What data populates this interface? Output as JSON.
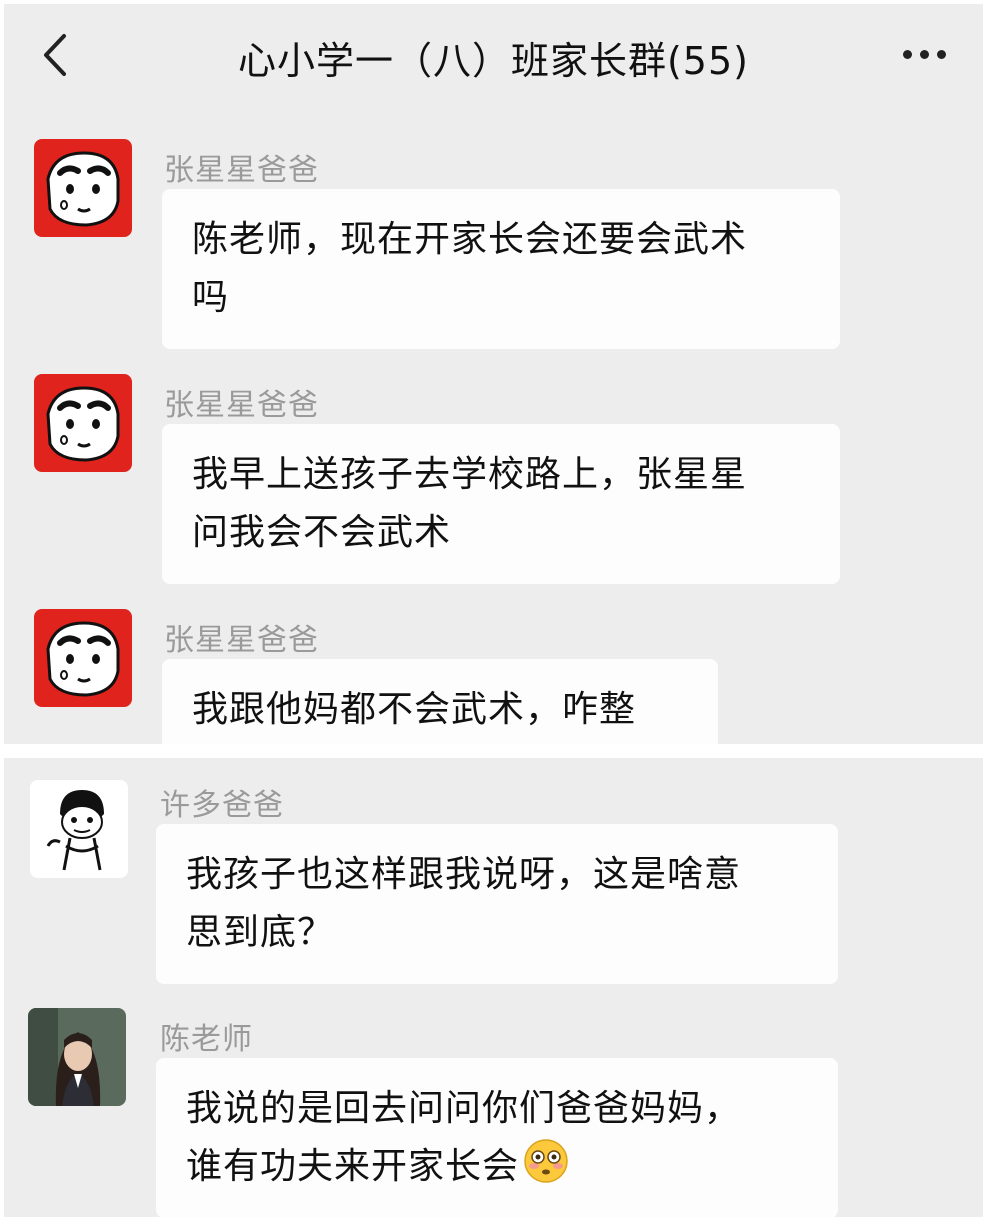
{
  "header": {
    "title": "心小学一（八）班家长群(55)"
  },
  "messages": [
    {
      "sender": "张星星爸爸",
      "lines": [
        "陈老师，现在开家长会还要会武术",
        "吗"
      ],
      "avatar": "crayon-shin-chan-icon"
    },
    {
      "sender": "张星星爸爸",
      "lines": [
        "我早上送孩子去学校路上，张星星",
        "问我会不会武术"
      ],
      "avatar": "crayon-shin-chan-icon"
    },
    {
      "sender": "张星星爸爸",
      "lines": [
        "我跟他妈都不会武术，咋整"
      ],
      "avatar": "crayon-shin-chan-icon"
    },
    {
      "sender": "许多爸爸",
      "lines": [
        "我孩子也这样跟我说呀，这是啥意",
        "思到底？"
      ],
      "avatar": "meme-face-icon"
    },
    {
      "sender": "陈老师",
      "lines": [
        "我说的是回去问问你们爸爸妈妈，",
        "谁有功夫来开家长会"
      ],
      "avatar": "girl-photo-icon"
    }
  ],
  "colors": {
    "background": "#ededed",
    "bubble": "#fdfdfd",
    "sender": "#9a9a9a",
    "avatar_red": "#e0231c"
  },
  "icons": {
    "back": "chevron-left-icon",
    "more": "more-dots-icon",
    "emoji": "flushed-face-emoji-icon"
  }
}
